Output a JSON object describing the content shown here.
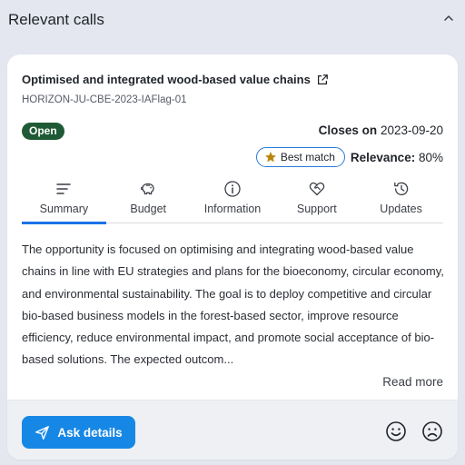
{
  "panel": {
    "title": "Relevant calls"
  },
  "card": {
    "title": "Optimised and integrated wood-based value chains",
    "call_id": "HORIZON-JU-CBE-2023-IAFlag-01",
    "status": "Open",
    "closes_label": "Closes on",
    "closes_date": "2023-09-20",
    "best_match": "Best match",
    "relevance_label": "Relevance:",
    "relevance_value": "80%",
    "tabs": [
      {
        "label": "Summary",
        "icon": "summary-icon",
        "active": true
      },
      {
        "label": "Budget",
        "icon": "piggy-bank-icon",
        "active": false
      },
      {
        "label": "Information",
        "icon": "info-icon",
        "active": false
      },
      {
        "label": "Support",
        "icon": "support-heart-icon",
        "active": false
      },
      {
        "label": "Updates",
        "icon": "history-icon",
        "active": false
      }
    ],
    "summary": "The opportunity is focused on optimising and integrating wood-based value chains in line with EU strategies and plans for the bioeconomy, circular economy, and environmental sustainability. The goal is to deploy competitive and circular bio-based business models in the forest-based sector, improve resource efficiency, reduce environmental impact, and promote social acceptance of bio-based solutions. The expected outcom...",
    "read_more": "Read more"
  },
  "footer": {
    "ask_label": "Ask details"
  },
  "colors": {
    "accent": "#1a73e8",
    "button": "#1787e5",
    "open_badge": "#1f5a36",
    "star": "#b8860b"
  }
}
